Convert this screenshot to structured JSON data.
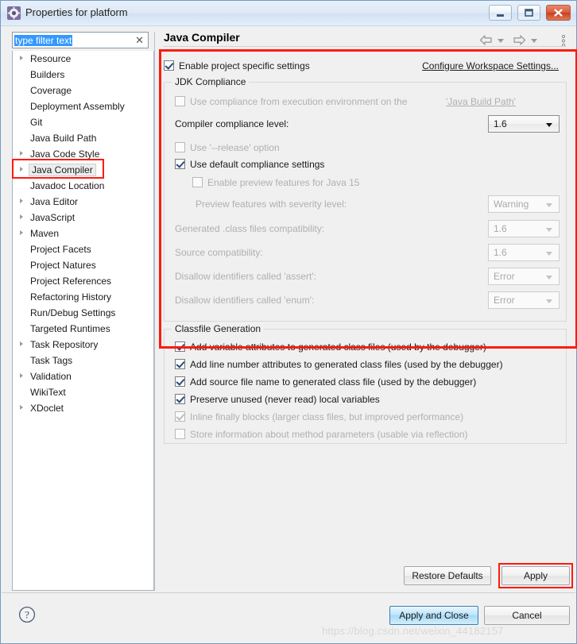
{
  "window": {
    "title": "Properties for platform",
    "icon": "gear-icon",
    "minimize_label": "Minimize",
    "maximize_label": "Maximize",
    "close_label": "Close"
  },
  "sidebar": {
    "filter": {
      "value": "type filter text",
      "placeholder": "type filter text",
      "clear_icon": "clear-icon"
    },
    "items": [
      {
        "label": "Resource",
        "expandable": true,
        "selected": false
      },
      {
        "label": "Builders",
        "expandable": false,
        "selected": false
      },
      {
        "label": "Coverage",
        "expandable": false,
        "selected": false
      },
      {
        "label": "Deployment Assembly",
        "expandable": false,
        "selected": false
      },
      {
        "label": "Git",
        "expandable": false,
        "selected": false
      },
      {
        "label": "Java Build Path",
        "expandable": false,
        "selected": false
      },
      {
        "label": "Java Code Style",
        "expandable": true,
        "selected": false
      },
      {
        "label": "Java Compiler",
        "expandable": true,
        "selected": true
      },
      {
        "label": "Javadoc Location",
        "expandable": false,
        "selected": false
      },
      {
        "label": "Java Editor",
        "expandable": true,
        "selected": false
      },
      {
        "label": "JavaScript",
        "expandable": true,
        "selected": false
      },
      {
        "label": "Maven",
        "expandable": true,
        "selected": false
      },
      {
        "label": "Project Facets",
        "expandable": false,
        "selected": false
      },
      {
        "label": "Project Natures",
        "expandable": false,
        "selected": false
      },
      {
        "label": "Project References",
        "expandable": false,
        "selected": false
      },
      {
        "label": "Refactoring History",
        "expandable": false,
        "selected": false
      },
      {
        "label": "Run/Debug Settings",
        "expandable": false,
        "selected": false
      },
      {
        "label": "Targeted Runtimes",
        "expandable": false,
        "selected": false
      },
      {
        "label": "Task Repository",
        "expandable": true,
        "selected": false
      },
      {
        "label": "Task Tags",
        "expandable": false,
        "selected": false
      },
      {
        "label": "Validation",
        "expandable": true,
        "selected": false
      },
      {
        "label": "WikiText",
        "expandable": false,
        "selected": false
      },
      {
        "label": "XDoclet",
        "expandable": true,
        "selected": false
      }
    ]
  },
  "page": {
    "title": "Java Compiler",
    "nav": {
      "back_icon": "arrow-left-icon",
      "back_caret_icon": "chevron-down-icon",
      "forward_icon": "arrow-right-icon",
      "forward_caret_icon": "chevron-down-icon",
      "menu_icon": "view-menu-icon"
    },
    "enable_project_specific": {
      "label": "Enable project specific settings",
      "checked": true
    },
    "configure_workspace_link": "Configure Workspace Settings...",
    "jdk_compliance": {
      "title": "JDK Compliance",
      "use_compliance_from_ee": {
        "label_prefix": "Use compliance from execution environment on the ",
        "link": "'Java Build Path'",
        "checked": false,
        "enabled": false
      },
      "compliance_level": {
        "label": "Compiler compliance level:",
        "value": "1.6",
        "enabled": true
      },
      "use_release_option": {
        "label": "Use '--release' option",
        "checked": false,
        "enabled": false
      },
      "use_default_compliance": {
        "label": "Use default compliance settings",
        "checked": true,
        "enabled": true
      },
      "enable_preview_features": {
        "label": "Enable preview features for Java 15",
        "checked": false,
        "enabled": false
      },
      "preview_severity": {
        "label": "Preview features with severity level:",
        "value": "Warning",
        "enabled": false
      },
      "class_files_compat": {
        "label": "Generated .class files compatibility:",
        "value": "1.6",
        "enabled": false
      },
      "source_compat": {
        "label": "Source compatibility:",
        "value": "1.6",
        "enabled": false
      },
      "disallow_assert": {
        "label": "Disallow identifiers called 'assert':",
        "value": "Error",
        "enabled": false
      },
      "disallow_enum": {
        "label": "Disallow identifiers called 'enum':",
        "value": "Error",
        "enabled": false
      }
    },
    "classfile_generation": {
      "title": "Classfile Generation",
      "options": [
        {
          "label": "Add variable attributes to generated class files (used by the debugger)",
          "checked": true,
          "enabled": true
        },
        {
          "label": "Add line number attributes to generated class files (used by the debugger)",
          "checked": true,
          "enabled": true
        },
        {
          "label": "Add source file name to generated class file (used by the debugger)",
          "checked": true,
          "enabled": true
        },
        {
          "label": "Preserve unused (never read) local variables",
          "checked": true,
          "enabled": true
        },
        {
          "label": "Inline finally blocks (larger class files, but improved performance)",
          "checked": true,
          "enabled": false
        },
        {
          "label": "Store information about method parameters (usable via reflection)",
          "checked": false,
          "enabled": false
        }
      ]
    }
  },
  "footer": {
    "restore_defaults": "Restore Defaults",
    "apply": "Apply",
    "apply_and_close": "Apply and Close",
    "cancel": "Cancel",
    "help_icon": "help-icon"
  },
  "watermark": "https://blog.csdn.net/weixin_44182157",
  "colors": {
    "annotation": "#ff1a0d",
    "selection": "#3399ff",
    "default_button": "#bee6fd",
    "close_button": "#db5a3b"
  }
}
